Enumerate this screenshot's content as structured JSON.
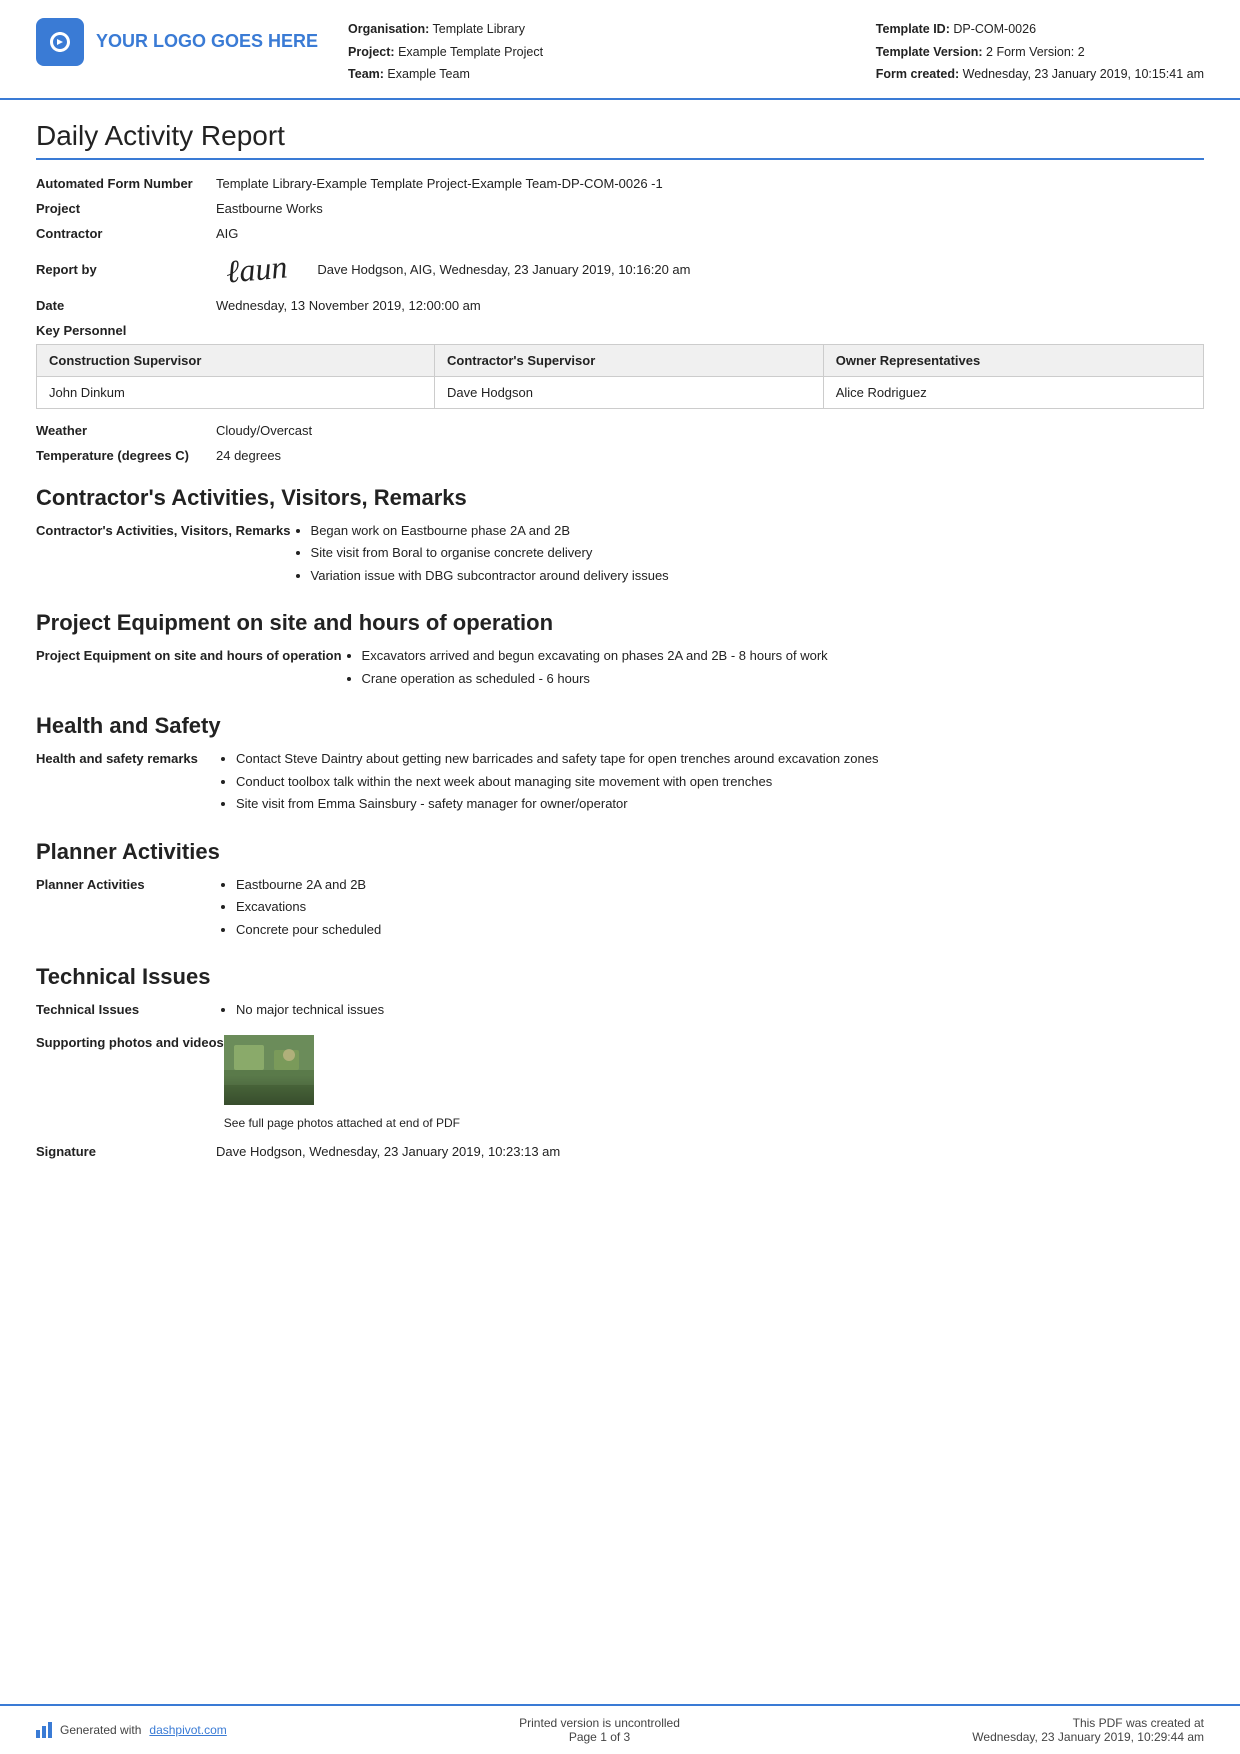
{
  "header": {
    "logo_text": "YOUR LOGO GOES HERE",
    "org_label": "Organisation:",
    "org_value": "Template Library",
    "project_label": "Project:",
    "project_value": "Example Template Project",
    "team_label": "Team:",
    "team_value": "Example Team",
    "template_id_label": "Template ID:",
    "template_id_value": "DP-COM-0026",
    "template_version_label": "Template Version:",
    "template_version_value": "2 Form Version: 2",
    "form_created_label": "Form created:",
    "form_created_value": "Wednesday, 23 January 2019, 10:15:41 am"
  },
  "report": {
    "title": "Daily Activity Report",
    "form_number_label": "Automated Form Number",
    "form_number_value": "Template Library-Example Template Project-Example Team-DP-COM-0026  -1",
    "project_label": "Project",
    "project_value": "Eastbourne Works",
    "contractor_label": "Contractor",
    "contractor_value": "AIG",
    "report_by_label": "Report by",
    "report_by_value": "Dave Hodgson, AIG, Wednesday, 23 January 2019, 10:16:20 am",
    "date_label": "Date",
    "date_value": "Wednesday, 13 November 2019, 12:00:00 am",
    "key_personnel_label": "Key Personnel",
    "personnel_table": {
      "headers": [
        "Construction Supervisor",
        "Contractor's Supervisor",
        "Owner Representatives"
      ],
      "rows": [
        [
          "John Dinkum",
          "Dave Hodgson",
          "Alice Rodriguez"
        ]
      ]
    },
    "weather_label": "Weather",
    "weather_value": "Cloudy/Overcast",
    "temperature_label": "Temperature (degrees C)",
    "temperature_value": "24 degrees"
  },
  "sections": {
    "contractors_activities": {
      "heading": "Contractor's Activities, Visitors, Remarks",
      "field_label": "Contractor's Activities, Visitors, Remarks",
      "items": [
        "Began work on Eastbourne phase 2A and 2B",
        "Site visit from Boral to organise concrete delivery",
        "Variation issue with DBG subcontractor around delivery issues"
      ]
    },
    "project_equipment": {
      "heading": "Project Equipment on site and hours of operation",
      "field_label": "Project Equipment on site and hours of operation",
      "items": [
        "Excavators arrived and begun excavating on phases 2A and 2B - 8 hours of work",
        "Crane operation as scheduled - 6 hours"
      ]
    },
    "health_safety": {
      "heading": "Health and Safety",
      "field_label": "Health and safety remarks",
      "items": [
        "Contact Steve Daintry about getting new barricades and safety tape for open trenches around excavation zones",
        "Conduct toolbox talk within the next week about managing site movement with open trenches",
        "Site visit from Emma Sainsbury - safety manager for owner/operator"
      ]
    },
    "planner_activities": {
      "heading": "Planner Activities",
      "field_label": "Planner Activities",
      "items": [
        "Eastbourne 2A and 2B",
        "Excavations",
        "Concrete pour scheduled"
      ]
    },
    "technical_issues": {
      "heading": "Technical Issues",
      "field_label": "Technical Issues",
      "items": [
        "No major technical issues"
      ],
      "supporting_label": "Supporting photos and videos",
      "supporting_caption": "See full page photos attached at end of PDF",
      "signature_label": "Signature",
      "signature_value": "Dave Hodgson, Wednesday, 23 January 2019, 10:23:13 am"
    }
  },
  "footer": {
    "generated_text": "Generated with ",
    "dashpivot_link": "dashpivot.com",
    "center_text": "Printed version is uncontrolled",
    "page_text": "Page 1 of 3",
    "right_text": "This PDF was created at",
    "right_date": "Wednesday, 23 January 2019, 10:29:44 am",
    "of_3": "of 3"
  }
}
